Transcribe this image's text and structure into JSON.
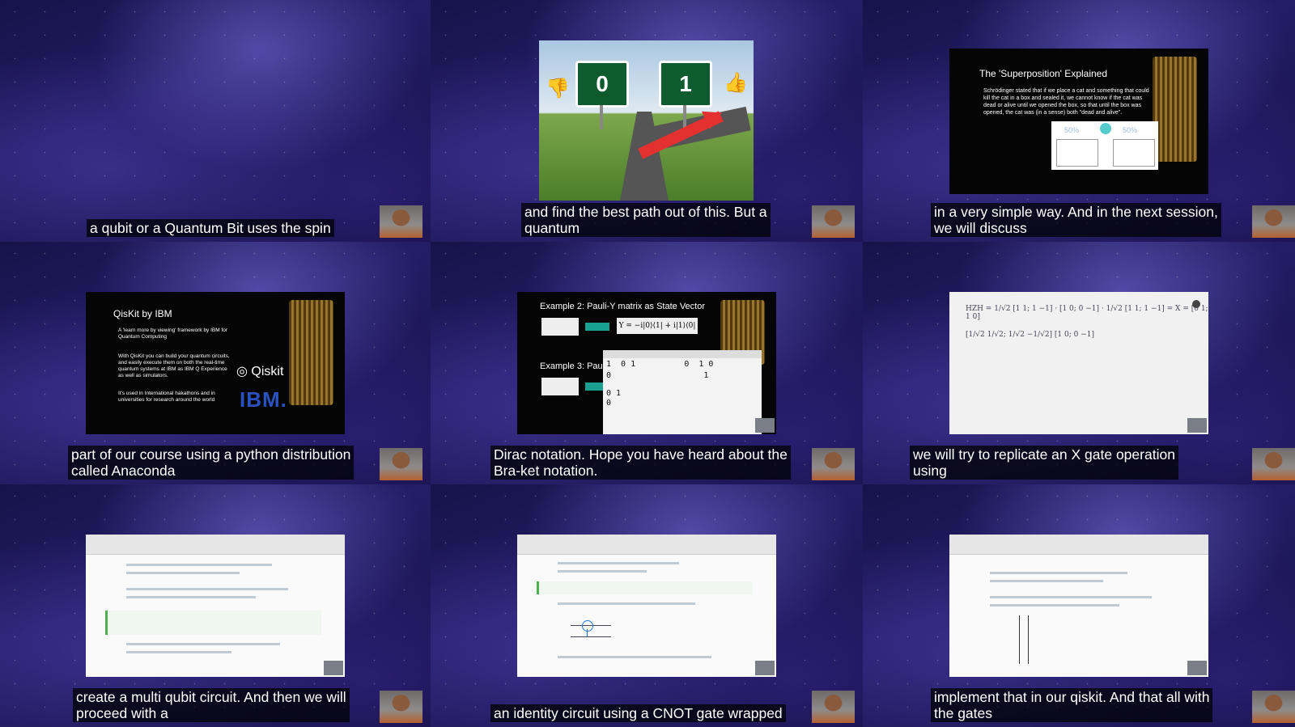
{
  "captions": [
    "a qubit or a Quantum Bit uses the spin",
    "and find the best path out of this. But a\nquantum",
    "in a very simple way. And in the next session,\nwe will discuss",
    "part of our course using a python distribution\ncalled Anaconda",
    "Dirac notation. Hope you have heard about the\nBra-ket notation.",
    "we will try to replicate an X gate operation\nusing",
    "create a multi qubit circuit. And then we will\nproceed with a",
    "an identity circuit using a CNOT gate wrapped",
    "implement that in our qiskit. And that all with\nthe gates"
  ],
  "road_slide": {
    "left_sign": "0",
    "right_sign": "1"
  },
  "superposition_slide": {
    "title": "The 'Superposition' Explained",
    "body": "Schrödinger stated that if we place a cat and something that could kill the cat in a box and sealed it, we cannot know if the cat was dead or alive until we opened the box, so that until the box was opened, the cat was (in a sense) both \"dead and alive\".",
    "left_pct": "50%",
    "right_pct": "50%"
  },
  "qiskit_slide": {
    "title": "QisKit by IBM",
    "bullet1": "A 'learn more by viewing' framework by IBM for Quantum Computing",
    "bullet2": "With QisKit you can build your quantum circuits, and easily execute them on both the real-time quantum systems at IBM as IBM Q Experience as well as simulators.",
    "bullet3": "It's used in International hakathons and in universities for research around the world",
    "logo_text": "Qiskit",
    "ibm": "IBM."
  },
  "pauli_slide": {
    "example2": "Example 2: Pauli-Y matrix as State Vector",
    "formula": "Y = −i|0⟩⟨1| + i|1⟩⟨0|",
    "example3": "Example 3: Pau",
    "output_row1": "1  0 1          0  1 0",
    "output_row2": "0                   1",
    "output_row3": "0 1",
    "output_row4": "0"
  },
  "whiteboard": {
    "line1": "HZH = 1/√2 [1 1; 1 −1] · [1 0; 0 −1] · 1/√2 [1 1; 1 −1] = X = [0 1; 1 0]",
    "line2": "[1/√2 1/√2; 1/√2 −1/√2] [1 0; 0 −1]"
  }
}
